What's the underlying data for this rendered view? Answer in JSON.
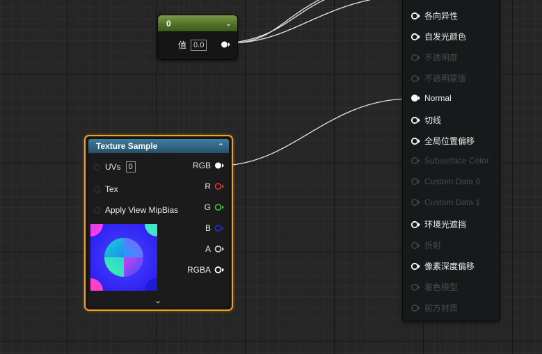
{
  "constant_node": {
    "title": "0",
    "param_label": "值",
    "param_value": "0.0"
  },
  "texture_sample_node": {
    "title": "Texture Sample",
    "inputs": [
      {
        "label": "UVs",
        "value": "0"
      },
      {
        "label": "Tex"
      },
      {
        "label": "Apply View MipBias"
      }
    ],
    "outputs": [
      {
        "label": "RGB",
        "color": "#ffffff"
      },
      {
        "label": "R",
        "color": "#e03030"
      },
      {
        "label": "G",
        "color": "#30c030"
      },
      {
        "label": "B",
        "color": "#2a2ad0"
      },
      {
        "label": "A",
        "color": "#cccccc"
      },
      {
        "label": "RGBA",
        "color": "#ffffff"
      }
    ]
  },
  "material_node": {
    "pins": [
      {
        "label": "各向异性",
        "enabled": true
      },
      {
        "label": "自发光颜色",
        "enabled": true
      },
      {
        "label": "不透明度",
        "enabled": false
      },
      {
        "label": "不透明蒙版",
        "enabled": false
      },
      {
        "label": "Normal",
        "enabled": true
      },
      {
        "label": "切线",
        "enabled": true
      },
      {
        "label": "全局位置偏移",
        "enabled": true
      },
      {
        "label": "Subsurface Color",
        "enabled": false
      },
      {
        "label": "Custom Data 0",
        "enabled": false
      },
      {
        "label": "Custom Data 1",
        "enabled": false
      },
      {
        "label": "环境光遮挡",
        "enabled": true
      },
      {
        "label": "折射",
        "enabled": false
      },
      {
        "label": "像素深度偏移",
        "enabled": true
      },
      {
        "label": "着色模型",
        "enabled": false
      },
      {
        "label": "前方材质",
        "enabled": false
      }
    ]
  },
  "colors": {
    "selection_outline": "#f0a21e",
    "constant_header": "#5a7a30",
    "texture_header": "#2f6a8c",
    "graph_bg": "#262626"
  }
}
